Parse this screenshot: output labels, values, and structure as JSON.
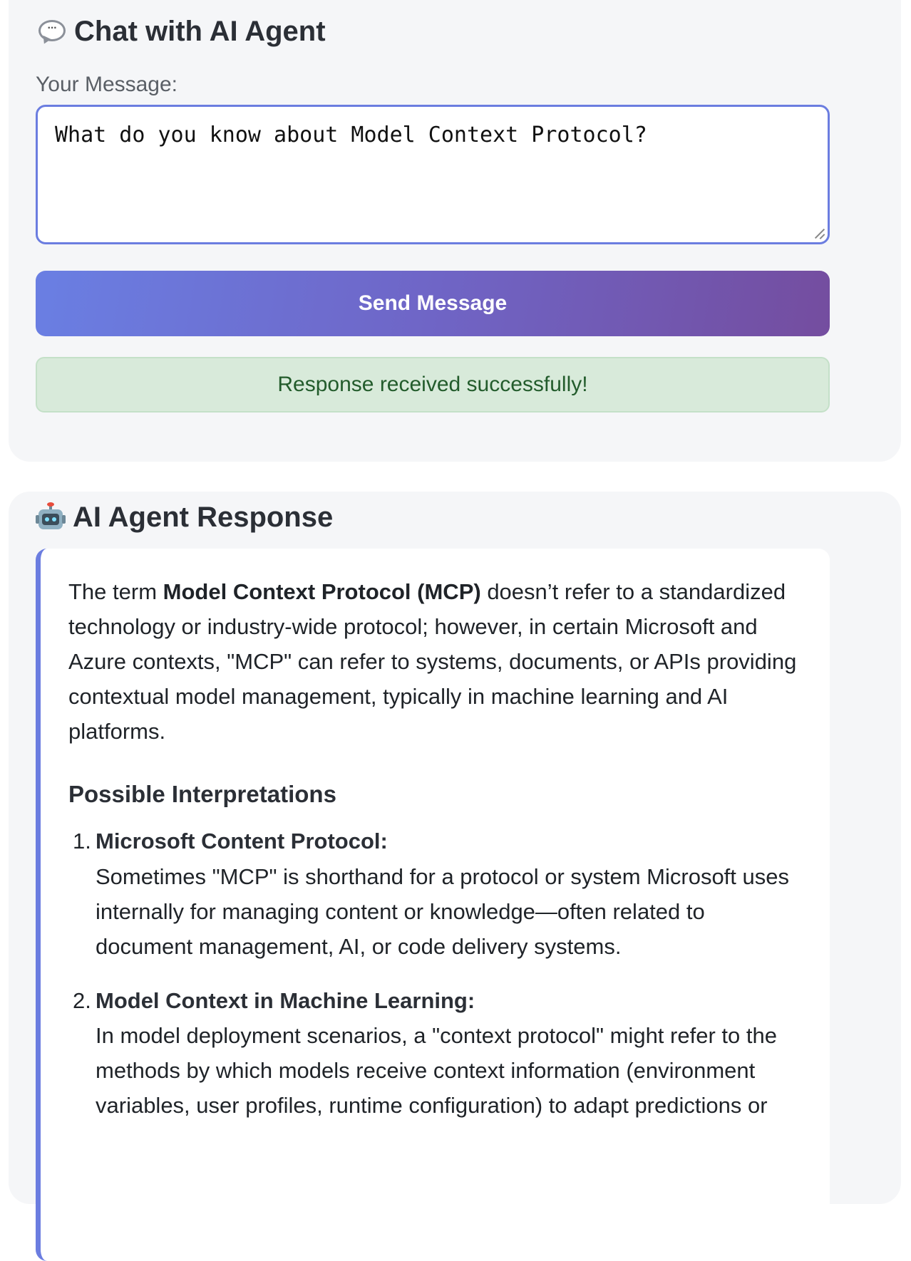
{
  "chat": {
    "title": "Chat with AI Agent",
    "title_icon": "speech-bubble-icon",
    "message_label": "Your Message:",
    "message_value": "What do you know about Model Context Protocol?",
    "send_label": "Send Message",
    "status_text": "Response received successfully!",
    "accent_color": "#6b7de0",
    "button_gradient": [
      "#6a7fe3",
      "#744d9f"
    ],
    "status_bg": "#d8eada",
    "status_color": "#235c2c"
  },
  "response": {
    "title": "AI Agent Response",
    "title_icon": "robot-icon",
    "intro": {
      "line1_pre": "The term ",
      "line1_bold": "Model Context Protocol (MCP)",
      "line1_post": " doesn’t refer to a standardized",
      "line2": "technology or industry-wide protocol; however, in certain Microsoft and",
      "line3": "Azure contexts, \"MCP\" can refer to systems, documents, or APIs providing",
      "line4": "contextual model management, typically in machine learning and AI",
      "line5": "platforms."
    },
    "heading": "Possible Interpretations",
    "items": [
      {
        "number": "1.",
        "title": "Microsoft Content Protocol:",
        "lines": [
          "Sometimes \"MCP\" is shorthand for a protocol or system Microsoft uses",
          "internally for managing content or knowledge—often related to",
          "document management, AI, or code delivery systems."
        ]
      },
      {
        "number": "2.",
        "title": "Model Context in Machine Learning:",
        "lines": [
          "In model deployment scenarios, a \"context protocol\" might refer to the",
          "methods by which models receive context information (environment",
          "variables, user profiles, runtime configuration) to adapt predictions or"
        ]
      }
    ]
  }
}
